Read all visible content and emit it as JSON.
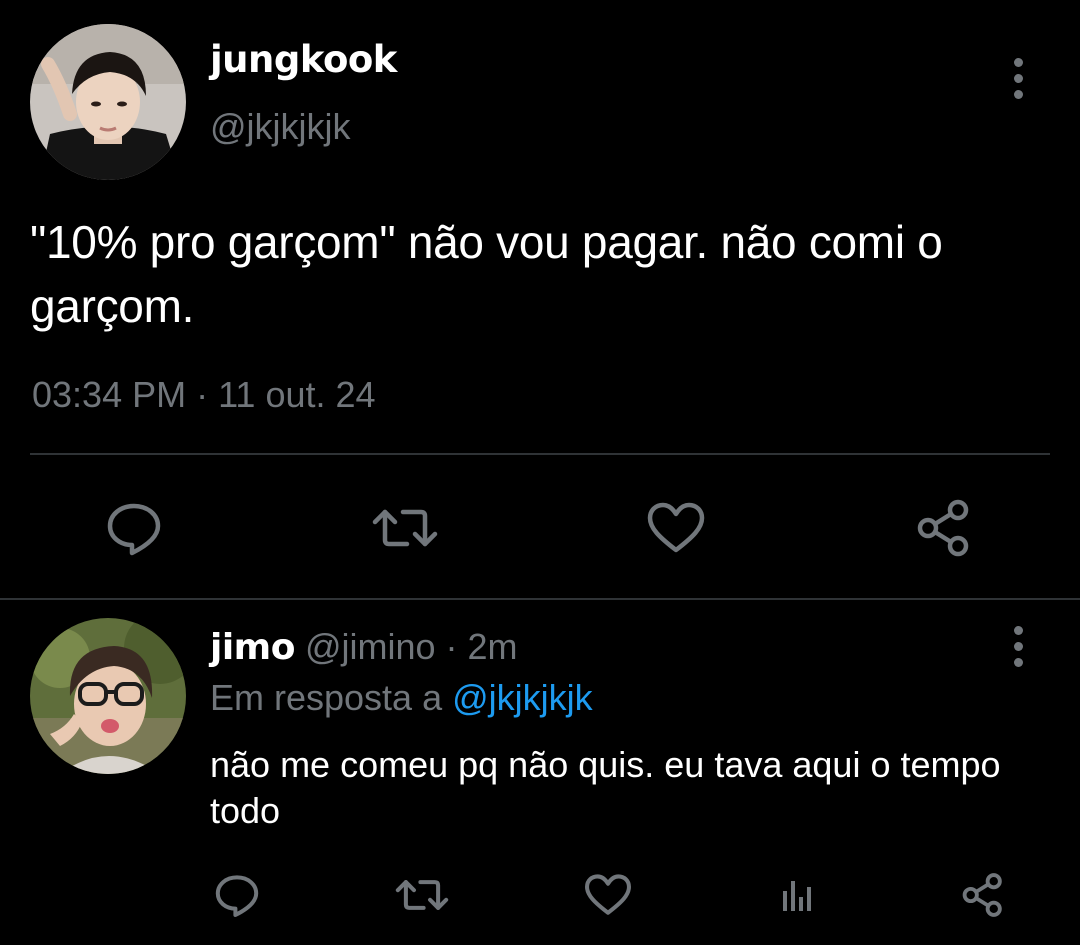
{
  "main_tweet": {
    "display_name": "jungkook",
    "handle": "@jkjkjkjk",
    "text": "\"10% pro garçom\" não vou pagar. não comi o garçom.",
    "timestamp": "03:34 PM · 11 out. 24",
    "actions": [
      "reply-icon",
      "retweet-icon",
      "like-icon",
      "share-icon"
    ]
  },
  "reply": {
    "display_name": "jimo",
    "handle": "@jimino",
    "separator": " · ",
    "time": "2m",
    "in_reply_prefix": "Em resposta a ",
    "in_reply_handle": "@jkjkjkjk",
    "text": "não me comeu pq não quis. eu tava aqui o tempo todo",
    "actions": [
      "reply-icon",
      "retweet-icon",
      "like-icon",
      "analytics-icon",
      "share-icon"
    ]
  },
  "colors": {
    "background": "#000000",
    "text": "#ffffff",
    "muted": "#71767b",
    "link": "#1d9bf0",
    "divider": "#2f3336"
  }
}
